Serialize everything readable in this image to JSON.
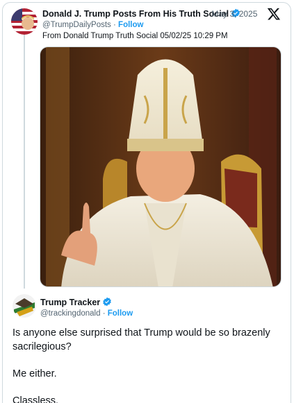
{
  "original_post": {
    "display_name": "Donald J. Trump Posts From His Truth Social",
    "separator": "·",
    "date": "May 3, 2025",
    "handle": "@TrumpDailyPosts",
    "follow_label": "Follow",
    "text": "From Donald Trump Truth Social 05/02/25 10:29 PM",
    "verified_icon": "verified-badge-icon",
    "brand_icon": "x-logo-icon"
  },
  "reply": {
    "display_name": "Trump Tracker",
    "handle": "@trackingdonald",
    "follow_label": "Follow",
    "paragraphs": [
      "Is anyone else surprised that Trump would be so brazenly sacrilegious?",
      "Me either.",
      "Classless."
    ]
  },
  "colors": {
    "link": "#1d9bf0",
    "secondary_text": "#536471",
    "border": "#cfd9de",
    "verified": "#1d9bf0"
  }
}
